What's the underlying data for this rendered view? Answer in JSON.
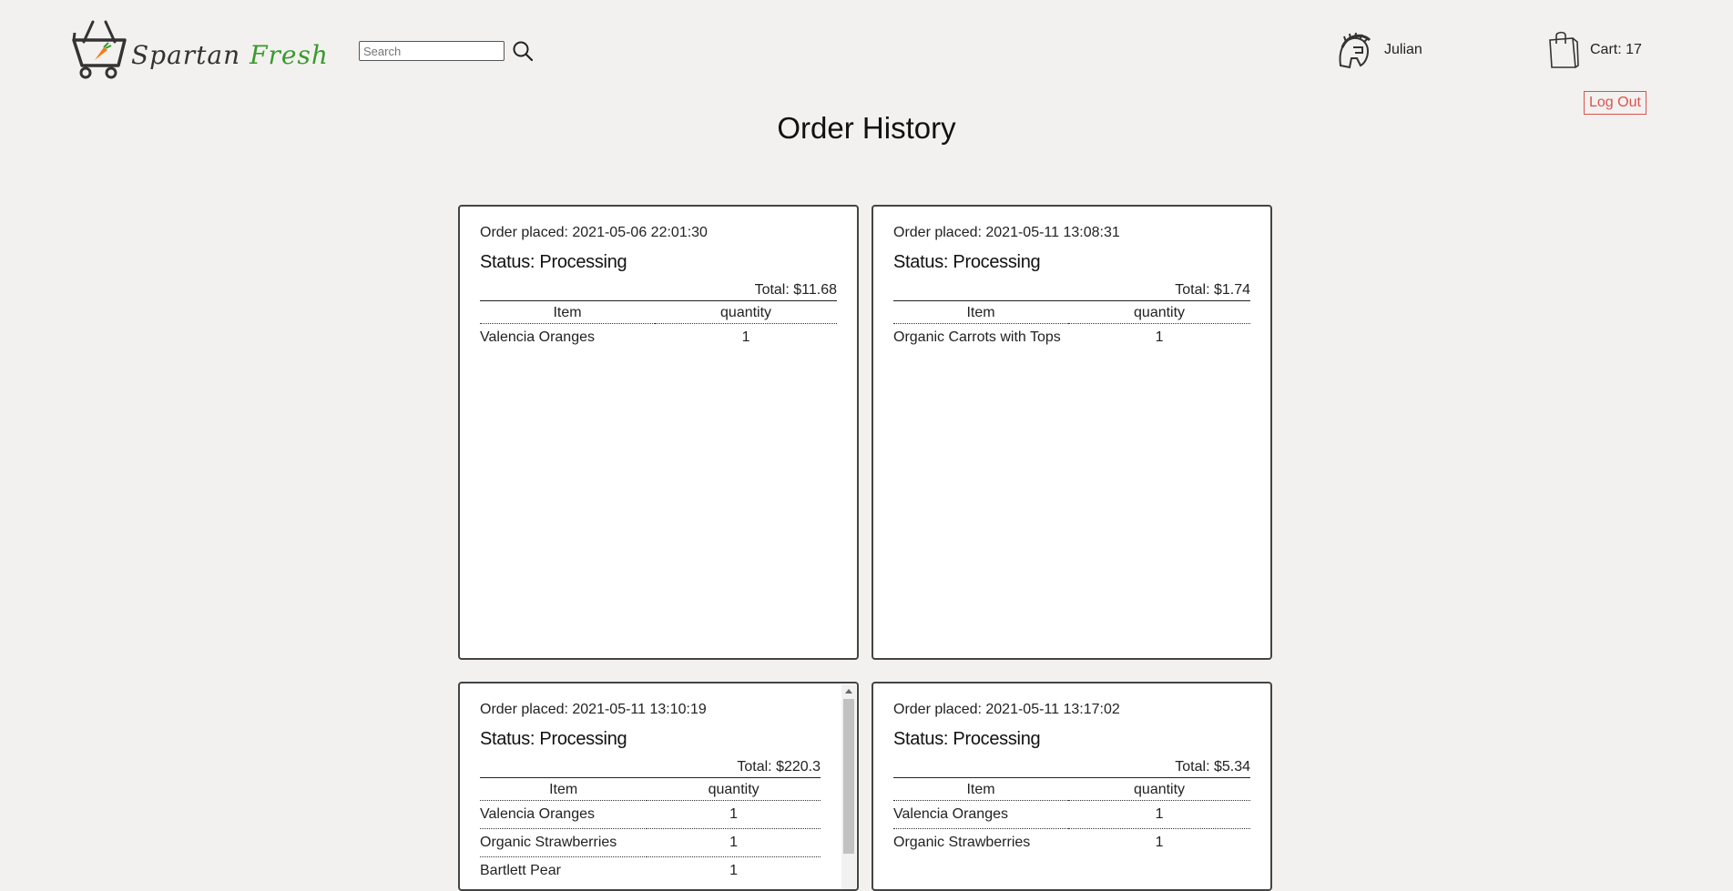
{
  "brand": {
    "name_part1": "Spartan",
    "name_part2": "Fresh",
    "accent_color": "#3a9a2e",
    "logo_icon": "cart-basket-carrot-icon"
  },
  "search": {
    "placeholder": "Search",
    "icon": "search-icon"
  },
  "user": {
    "name": "Julian",
    "icon": "spartan-helmet-icon"
  },
  "cart": {
    "label": "Cart: 17",
    "icon": "shopping-bag-icon"
  },
  "logout_label": "Log Out",
  "page_title": "Order History",
  "orders": [
    {
      "placed": "Order placed: 2021-05-06 22:01:30",
      "status": "Status: Processing",
      "total": "Total: $11.68",
      "col_item": "Item",
      "col_qty": "quantity",
      "items": [
        {
          "name": "Valencia Oranges",
          "qty": "1"
        }
      ]
    },
    {
      "placed": "Order placed: 2021-05-11 13:08:31",
      "status": "Status: Processing",
      "total": "Total: $1.74",
      "col_item": "Item",
      "col_qty": "quantity",
      "items": [
        {
          "name": "Organic Carrots with Tops",
          "qty": "1"
        }
      ]
    },
    {
      "placed": "Order placed: 2021-05-11 13:10:19",
      "status": "Status: Processing",
      "total": "Total: $220.3",
      "col_item": "Item",
      "col_qty": "quantity",
      "items": [
        {
          "name": "Valencia Oranges",
          "qty": "1"
        },
        {
          "name": "Organic Strawberries",
          "qty": "1"
        },
        {
          "name": "Bartlett Pear",
          "qty": "1"
        }
      ]
    },
    {
      "placed": "Order placed: 2021-05-11 13:17:02",
      "status": "Status: Processing",
      "total": "Total: $5.34",
      "col_item": "Item",
      "col_qty": "quantity",
      "items": [
        {
          "name": "Valencia Oranges",
          "qty": "1"
        },
        {
          "name": "Organic Strawberries",
          "qty": "1"
        }
      ]
    }
  ]
}
